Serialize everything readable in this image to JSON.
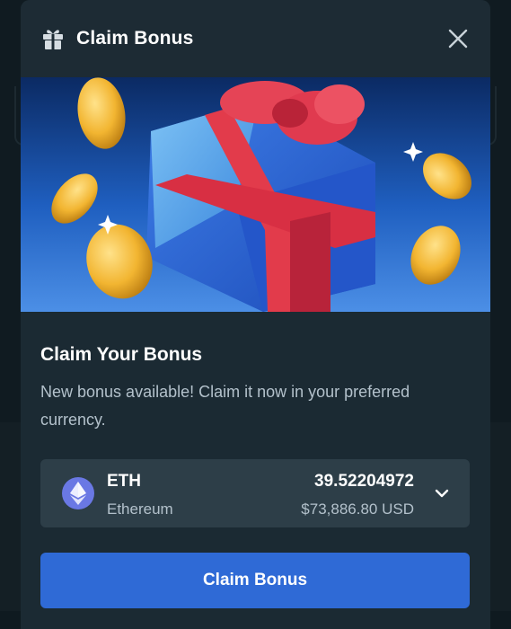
{
  "modal": {
    "title": "Claim Bonus",
    "icons": {
      "header": "gift-icon",
      "close": "close-icon",
      "currency": "ethereum-icon",
      "dropdown": "chevron-down-icon"
    }
  },
  "content": {
    "heading": "Claim Your Bonus",
    "description": "New bonus available! Claim it now in your preferred currency."
  },
  "currency": {
    "symbol": "ETH",
    "name": "Ethereum",
    "amount": "39.52204972",
    "usd_value": "$73,886.80 USD"
  },
  "actions": {
    "claim_label": "Claim Bonus"
  },
  "colors": {
    "modal_bg": "#1b2a33",
    "accent": "#2f6ad6",
    "select_bg": "#2d3e48",
    "eth_badge": "#6a78e4"
  }
}
